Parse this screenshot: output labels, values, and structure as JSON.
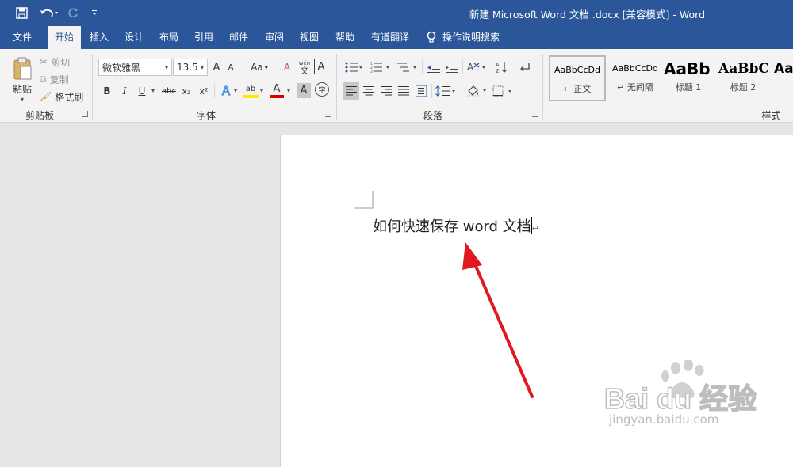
{
  "window": {
    "title": "新建 Microsoft Word 文档 .docx [兼容模式]  -  Word"
  },
  "quick_access": {
    "save_icon": "save-icon",
    "undo_icon": "undo-icon",
    "redo_icon": "redo-icon",
    "customize_icon": "customize-qat-icon"
  },
  "menu": {
    "items": [
      "文件",
      "开始",
      "插入",
      "设计",
      "布局",
      "引用",
      "邮件",
      "审阅",
      "视图",
      "帮助",
      "有道翻译"
    ],
    "active": "开始",
    "tell_me": "操作说明搜索"
  },
  "ribbon": {
    "clipboard": {
      "paste": "粘贴",
      "cut": "剪切",
      "copy": "复制",
      "format_painter": "格式刷",
      "label": "剪贴板"
    },
    "font": {
      "font_name": "微软雅黑",
      "font_size": "13.5",
      "grow": "A",
      "shrink": "A",
      "change_case": "Aa",
      "clear": "A",
      "char_border": "A",
      "bold": "B",
      "italic": "I",
      "underline": "U",
      "strike": "abc",
      "subscript": "x₂",
      "superscript": "x²",
      "text_effect": "A",
      "highlight": "ab",
      "font_color": "A",
      "char_shade": "A",
      "enclose": "字",
      "label": "字体"
    },
    "paragraph": {
      "label": "段落"
    },
    "styles": {
      "label": "样式",
      "items": [
        {
          "sample": "AaBbCcDd",
          "name": "↵ 正文"
        },
        {
          "sample": "AaBbCcDd",
          "name": "↵ 无间隔"
        },
        {
          "sample": "AaBb",
          "name": "标题 1"
        },
        {
          "sample": "AaBbC",
          "name": "标题 2"
        },
        {
          "sample": "Aa",
          "name": ""
        }
      ]
    }
  },
  "document": {
    "text": "如何快速保存 word 文档"
  },
  "watermark": {
    "brand": "Bai du 经验",
    "url": "jingyan.baidu.com"
  },
  "colors": {
    "accent": "#2b579a",
    "arrow": "#e0191f"
  }
}
